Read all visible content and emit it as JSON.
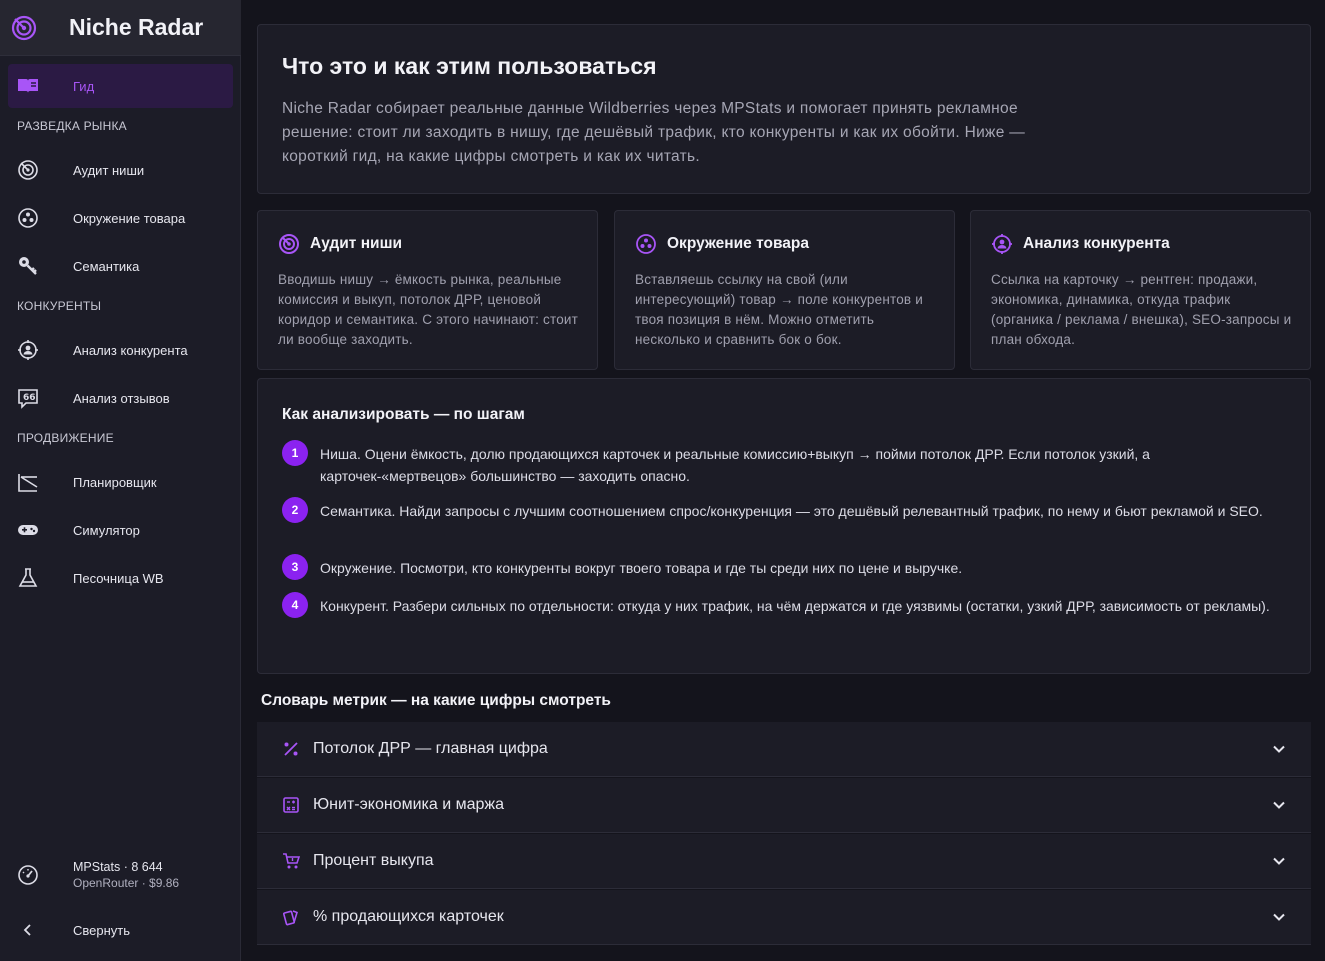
{
  "brand": {
    "title": "Niche Radar",
    "icon": "radar-icon"
  },
  "colors": {
    "accent": "#a855f7",
    "background": "#14141c",
    "card": "#1c1c26"
  },
  "sidebar": {
    "active": {
      "label": "Гид",
      "icon": "book-icon"
    },
    "sections": [
      {
        "title": "РАЗВЕДКА РЫНКА",
        "items": [
          {
            "label": "Аудит ниши",
            "icon": "radar-icon"
          },
          {
            "label": "Окружение товара",
            "icon": "circles-icon"
          },
          {
            "label": "Семантика",
            "icon": "key-icon"
          }
        ]
      },
      {
        "title": "КОНКУРЕНТЫ",
        "items": [
          {
            "label": "Анализ конкурента",
            "icon": "crosshair-user-icon"
          },
          {
            "label": "Анализ отзывов",
            "icon": "review-quote-icon"
          }
        ]
      },
      {
        "title": "ПРОДВИЖЕНИЕ",
        "items": [
          {
            "label": "Планировщик",
            "icon": "chart-plan-icon"
          },
          {
            "label": "Симулятор",
            "icon": "gamepad-icon"
          },
          {
            "label": "Песочница WB",
            "icon": "flask-icon"
          }
        ]
      }
    ],
    "usage": {
      "line1": "MPStats · 8 644",
      "line2": "OpenRouter · $9.86",
      "icon": "gauge-icon"
    },
    "collapse": {
      "label": "Свернуть",
      "icon": "chevron-left-icon"
    }
  },
  "intro": {
    "title": "Что это и как этим пользоваться",
    "text": "Niche Radar собирает реальные данные Wildberries через MPStats и помогает принять рекламное решение: стоит ли заходить в нишу, где дешёвый трафик, кто конкуренты и как их обойти. Ниже — короткий гид, на какие цифры смотреть и как их читать."
  },
  "features": [
    {
      "title": "Аудит ниши",
      "icon": "radar-icon",
      "text": "Вводишь нишу → ёмкость рынка, реальные комиссия и выкуп, потолок ДРР, ценовой коридор и семантика. С этого начинают: стоит ли вообще заходить."
    },
    {
      "title": "Окружение товара",
      "icon": "circles-icon",
      "text": "Вставляешь ссылку на свой (или интересующий) товар → поле конкурентов и твоя позиция в нём. Можно отметить несколько и сравнить бок о бок."
    },
    {
      "title": "Анализ конкурента",
      "icon": "crosshair-user-icon",
      "text": "Ссылка на карточку → рентген: продажи, экономика, динамика, откуда трафик (органика / реклама / внешка), SEO-запросы и план обхода."
    }
  ],
  "steps": {
    "title": "Как анализировать — по шагам",
    "items": [
      {
        "num": "1",
        "text": "Ниша. Оцени ёмкость, долю продающихся карточек и реальные комиссию+выкуп → пойми потолок ДРР. Если потолок узкий, а карточек-«мертвецов» большинство — заходить опасно."
      },
      {
        "num": "2",
        "text": "Семантика. Найди запросы с лучшим соотношением спрос/конкуренция — это дешёвый релевантный трафик, по нему и бьют рекламой и SEO."
      },
      {
        "num": "3",
        "text": "Окружение. Посмотри, кто конкуренты вокруг твоего товара и где ты среди них по цене и выручке."
      },
      {
        "num": "4",
        "text": "Конкурент. Разбери сильных по отдельности: откуда у них трафик, на чём держатся и где уязвимы (остатки, узкий ДРР, зависимость от рекламы)."
      }
    ]
  },
  "dictionary": {
    "title": "Словарь метрик — на какие цифры смотреть",
    "items": [
      {
        "label": "Потолок ДРР — главная цифра",
        "icon": "percent-icon"
      },
      {
        "label": "Юнит-экономика и маржа",
        "icon": "calculator-icon"
      },
      {
        "label": "Процент выкупа",
        "icon": "cart-icon"
      },
      {
        "label": "% продающихся карточек",
        "icon": "cards-icon"
      }
    ]
  }
}
